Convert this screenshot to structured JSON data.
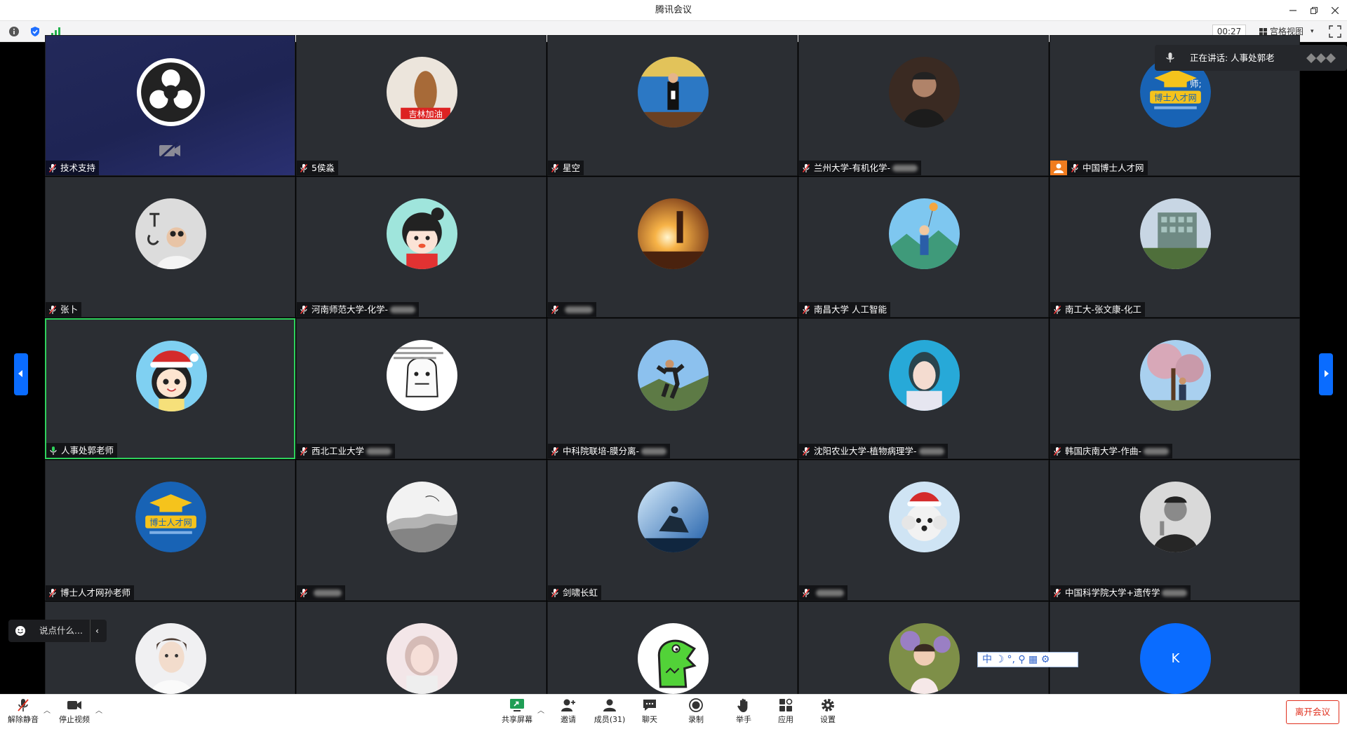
{
  "window": {
    "title": "腾讯会议"
  },
  "infobar": {
    "timer": "00:27",
    "view_label": "宫格视图"
  },
  "speaker": {
    "text": "正在讲话: 人事处郭老师;"
  },
  "chat": {
    "placeholder": "说点什么..."
  },
  "ime": {
    "text": "中 ☽ °, ⚲ ▦ ⚙"
  },
  "tiles": [
    {
      "name": "技术支持",
      "avatar": "obs-logo",
      "video_off": true
    },
    {
      "name": "5侯淼",
      "avatar": "violin"
    },
    {
      "name": "星空",
      "avatar": "teacher-stage"
    },
    {
      "name": "兰州大学-有机化学-",
      "avatar": "man-portrait"
    },
    {
      "name": "中国博士人才网",
      "avatar": "boshi-logo",
      "host": true
    },
    {
      "name": "张卜",
      "avatar": "selfie-ok"
    },
    {
      "name": "河南师范大学-化学-",
      "avatar": "cartoon-girl"
    },
    {
      "name": "",
      "avatar": "sunset"
    },
    {
      "name": "南昌大学 人工智能",
      "avatar": "balloon"
    },
    {
      "name": "南工大-张文康-化工",
      "avatar": "building"
    },
    {
      "name": "人事处郭老师",
      "avatar": "cartoon-santa",
      "active": true
    },
    {
      "name": "西北工业大学",
      "avatar": "meme-face"
    },
    {
      "name": "中科院联培-膜分离-",
      "avatar": "hiker"
    },
    {
      "name": "沈阳农业大学-植物病理学-",
      "avatar": "blur-girl"
    },
    {
      "name": "韩国庆南大学-作曲-",
      "avatar": "tree-person"
    },
    {
      "name": "博士人才网孙老师",
      "avatar": "boshi-logo"
    },
    {
      "name": "",
      "avatar": "ink-landscape"
    },
    {
      "name": "剑啸长虹",
      "avatar": "rider"
    },
    {
      "name": "",
      "avatar": "dog-hat"
    },
    {
      "name": "中国科学院大学+遗传学",
      "avatar": "bw-man"
    },
    {
      "name": "",
      "avatar": "young-man"
    },
    {
      "name": "",
      "avatar": "blur-woman"
    },
    {
      "name": "",
      "avatar": "green-croc"
    },
    {
      "name": "",
      "avatar": "child"
    },
    {
      "name": "",
      "avatar": "letter-k",
      "letter": "K"
    }
  ],
  "toolbar": {
    "unmute": "解除静音",
    "stop_video": "停止视频",
    "share": "共享屏幕",
    "invite": "邀请",
    "members": "成员(31)",
    "chat": "聊天",
    "record": "录制",
    "raise_hand": "举手",
    "apps": "应用",
    "settings": "设置",
    "leave": "离开会议"
  },
  "colors": {
    "accent": "#0a6cff",
    "leave": "#e0301e",
    "active_border": "#2fd15c",
    "tile_bg": "#2b2e33"
  }
}
